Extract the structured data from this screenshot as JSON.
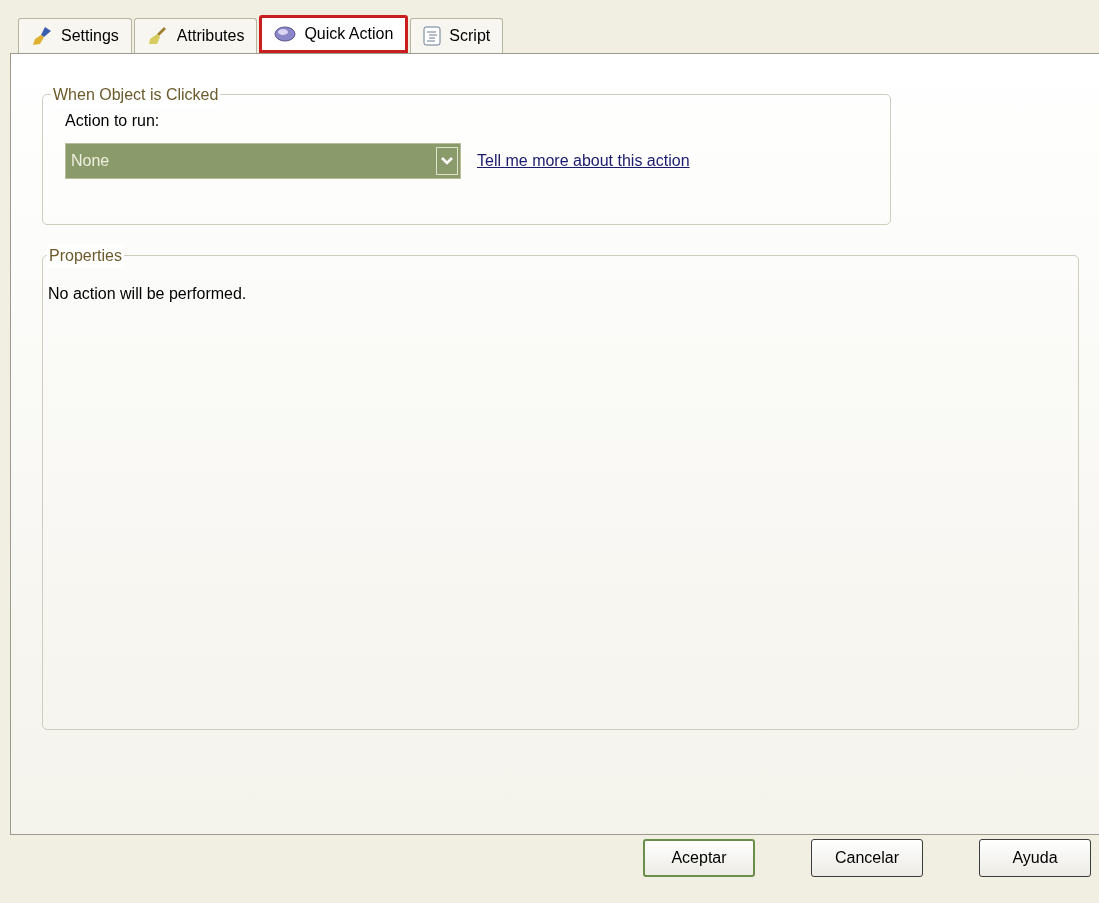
{
  "tabs": [
    {
      "label": "Settings",
      "selected": false,
      "highlighted": false,
      "kind": "brush"
    },
    {
      "label": "Attributes",
      "selected": false,
      "highlighted": false,
      "kind": "broom"
    },
    {
      "label": "Quick Action",
      "selected": true,
      "highlighted": true,
      "kind": "disc"
    },
    {
      "label": "Script",
      "selected": false,
      "highlighted": false,
      "kind": "script"
    }
  ],
  "click_group": {
    "title": "When Object is Clicked",
    "label": "Action to run:",
    "dropdown": {
      "value": "None"
    },
    "link": "Tell me more about this action"
  },
  "properties_group": {
    "title": "Properties",
    "text": "No action will be performed."
  },
  "buttons": [
    {
      "label": "Aceptar",
      "default": true
    },
    {
      "label": "Cancelar",
      "default": false
    },
    {
      "label": "Ayuda",
      "default": false
    }
  ]
}
